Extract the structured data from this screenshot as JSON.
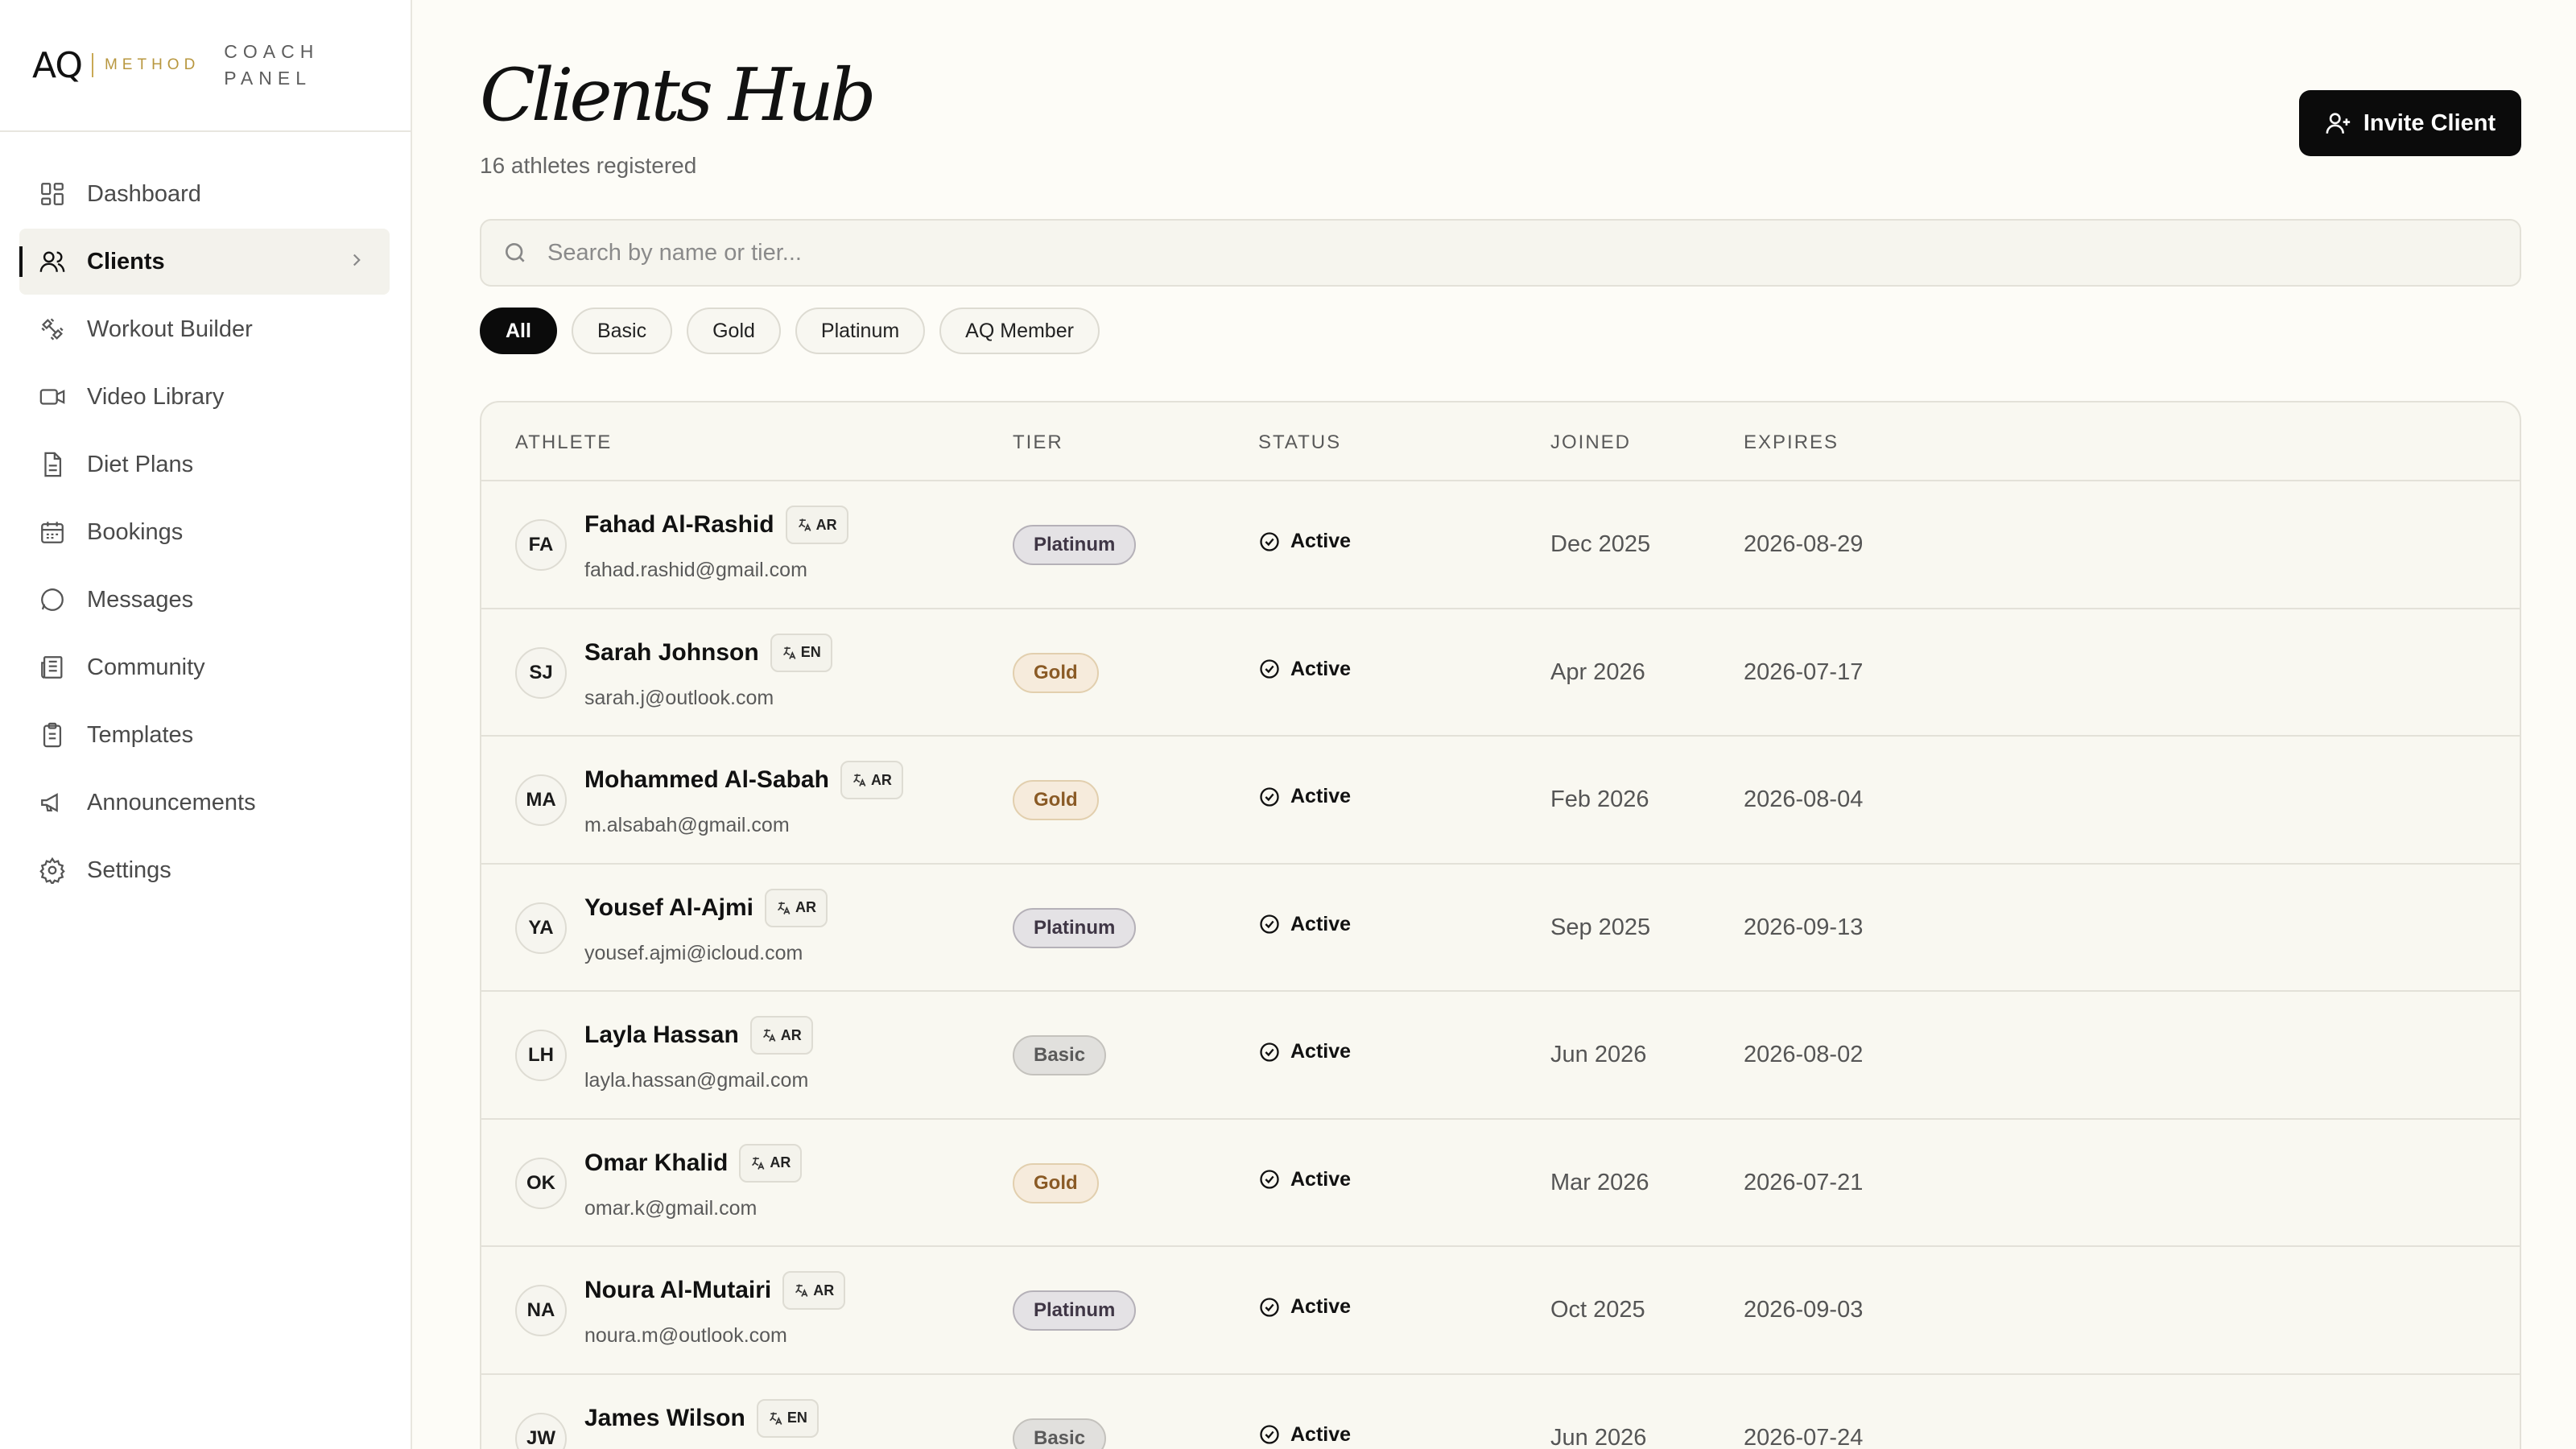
{
  "brand": {
    "mark": "AQ",
    "method": "METHOD",
    "panel_line1": "COACH",
    "panel_line2": "PANEL"
  },
  "nav": [
    {
      "label": "Dashboard",
      "icon": "dashboard-icon"
    },
    {
      "label": "Clients",
      "icon": "users-icon",
      "active": true
    },
    {
      "label": "Workout Builder",
      "icon": "dumbbell-icon"
    },
    {
      "label": "Video Library",
      "icon": "video-icon"
    },
    {
      "label": "Diet Plans",
      "icon": "document-icon"
    },
    {
      "label": "Bookings",
      "icon": "calendar-icon"
    },
    {
      "label": "Messages",
      "icon": "message-icon"
    },
    {
      "label": "Community",
      "icon": "newspaper-icon"
    },
    {
      "label": "Templates",
      "icon": "clipboard-icon"
    },
    {
      "label": "Announcements",
      "icon": "megaphone-icon"
    },
    {
      "label": "Settings",
      "icon": "gear-icon"
    }
  ],
  "header": {
    "title": "Clients Hub",
    "subtitle": "16 athletes registered",
    "invite_label": "Invite Client"
  },
  "search": {
    "placeholder": "Search by name or tier..."
  },
  "filters": [
    "All",
    "Basic",
    "Gold",
    "Platinum",
    "AQ Member"
  ],
  "table": {
    "columns": [
      "ATHLETE",
      "TIER",
      "STATUS",
      "JOINED",
      "EXPIRES"
    ],
    "rows": [
      {
        "initials": "FA",
        "name": "Fahad Al-Rashid",
        "lang": "AR",
        "email": "fahad.rashid@gmail.com",
        "tier": "Platinum",
        "status": "Active",
        "joined": "Dec 2025",
        "expires": "2026-08-29"
      },
      {
        "initials": "SJ",
        "name": "Sarah Johnson",
        "lang": "EN",
        "email": "sarah.j@outlook.com",
        "tier": "Gold",
        "status": "Active",
        "joined": "Apr 2026",
        "expires": "2026-07-17"
      },
      {
        "initials": "MA",
        "name": "Mohammed Al-Sabah",
        "lang": "AR",
        "email": "m.alsabah@gmail.com",
        "tier": "Gold",
        "status": "Active",
        "joined": "Feb 2026",
        "expires": "2026-08-04"
      },
      {
        "initials": "YA",
        "name": "Yousef Al-Ajmi",
        "lang": "AR",
        "email": "yousef.ajmi@icloud.com",
        "tier": "Platinum",
        "status": "Active",
        "joined": "Sep 2025",
        "expires": "2026-09-13"
      },
      {
        "initials": "LH",
        "name": "Layla Hassan",
        "lang": "AR",
        "email": "layla.hassan@gmail.com",
        "tier": "Basic",
        "status": "Active",
        "joined": "Jun 2026",
        "expires": "2026-08-02"
      },
      {
        "initials": "OK",
        "name": "Omar Khalid",
        "lang": "AR",
        "email": "omar.k@gmail.com",
        "tier": "Gold",
        "status": "Active",
        "joined": "Mar 2026",
        "expires": "2026-07-21"
      },
      {
        "initials": "NA",
        "name": "Noura Al-Mutairi",
        "lang": "AR",
        "email": "noura.m@outlook.com",
        "tier": "Platinum",
        "status": "Active",
        "joined": "Oct 2025",
        "expires": "2026-09-03"
      },
      {
        "initials": "JW",
        "name": "James Wilson",
        "lang": "EN",
        "email": "",
        "tier": "Basic",
        "status": "Active",
        "joined": "Jun 2026",
        "expires": "2026-07-24"
      }
    ]
  },
  "colors": {
    "accent": "#0b0b0b",
    "brand_gold": "#b8973f",
    "background": "#fdfcf7"
  }
}
